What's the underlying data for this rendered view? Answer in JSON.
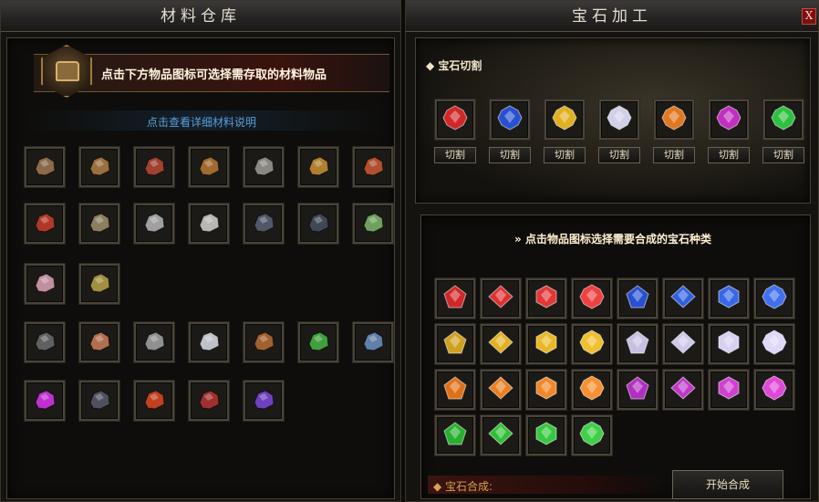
{
  "left_panel": {
    "title": "材料仓库",
    "hint": "点击下方物品图标可选择需存取的材料物品",
    "detail_link": "点击查看详细材料说明",
    "rows": [
      [
        {
          "icon": "wood-logs-icon",
          "c": "#8a6a4a"
        },
        {
          "icon": "wood-branch-icon",
          "c": "#9a7040"
        },
        {
          "icon": "red-wood-chips-icon",
          "c": "#a04030"
        },
        {
          "icon": "wood-chips-icon",
          "c": "#a06a30"
        },
        {
          "icon": "stone-slab-icon",
          "c": "#8a8880"
        },
        {
          "icon": "golden-planks-icon",
          "c": "#b08030"
        },
        {
          "icon": "red-planks-icon",
          "c": "#b05030"
        }
      ],
      [
        {
          "icon": "red-lumber-icon",
          "c": "#b03828"
        },
        {
          "icon": "mixed-ore-icon",
          "c": "#8a8060"
        },
        {
          "icon": "silver-ore-icon",
          "c": "#a0a0a0"
        },
        {
          "icon": "grey-ore-icon",
          "c": "#b8b8b0"
        },
        {
          "icon": "dark-ore-icon",
          "c": "#505868"
        },
        {
          "icon": "black-crystal-icon",
          "c": "#404858"
        },
        {
          "icon": "green-ore-icon",
          "c": "#70a060"
        }
      ],
      [
        {
          "icon": "pink-crystal-ore-icon",
          "c": "#c090a0"
        },
        {
          "icon": "gold-ore-icon",
          "c": "#a09040"
        }
      ],
      [
        {
          "icon": "coal-ore-icon",
          "c": "#606060"
        },
        {
          "icon": "copper-ore-icon",
          "c": "#b07050"
        },
        {
          "icon": "iron-ore-icon",
          "c": "#909090"
        },
        {
          "icon": "mithril-ore-icon",
          "c": "#c0c0c8"
        },
        {
          "icon": "amber-ore-icon",
          "c": "#a06030"
        },
        {
          "icon": "emerald-ore-icon",
          "c": "#40a040"
        },
        {
          "icon": "blue-stone-icon",
          "c": "#6080a8"
        }
      ],
      [
        {
          "icon": "purple-gem-icon",
          "c": "#c030d0"
        },
        {
          "icon": "obsidian-ore-icon",
          "c": "#505060"
        },
        {
          "icon": "fire-rune-icon",
          "c": "#c04020"
        },
        {
          "icon": "blood-rune-icon",
          "c": "#a03030"
        },
        {
          "icon": "violet-shard-icon",
          "c": "#7040c0"
        }
      ]
    ]
  },
  "right_panel": {
    "title": "宝石加工",
    "close_label": "X",
    "cut_section_title": "宝石切割",
    "cut_button_label": "切割",
    "cut_gems": [
      {
        "icon": "ruby-cluster-icon",
        "c": "#d02828"
      },
      {
        "icon": "sapphire-cluster-icon",
        "c": "#2850d0"
      },
      {
        "icon": "topaz-cluster-icon",
        "c": "#e0b020"
      },
      {
        "icon": "diamond-cluster-icon",
        "c": "#d0d0e8"
      },
      {
        "icon": "amber-cluster-icon",
        "c": "#e07820"
      },
      {
        "icon": "amethyst-cluster-icon",
        "c": "#c030c0"
      },
      {
        "icon": "emerald-cluster-icon",
        "c": "#30c040"
      }
    ],
    "synth_title": "点击物品图标选择需要合成的宝石种类",
    "synth_rows": [
      [
        {
          "icon": "ruby-gem-1-icon",
          "c": "#d02828"
        },
        {
          "icon": "ruby-gem-2-icon",
          "c": "#e03030"
        },
        {
          "icon": "ruby-gem-3-icon",
          "c": "#e03838"
        },
        {
          "icon": "ruby-gem-4-icon",
          "c": "#f04040"
        },
        {
          "icon": "sapphire-gem-1-icon",
          "c": "#2850d0"
        },
        {
          "icon": "sapphire-gem-2-icon",
          "c": "#3060e0"
        },
        {
          "icon": "sapphire-gem-3-icon",
          "c": "#3868e8"
        },
        {
          "icon": "sapphire-gem-4-icon",
          "c": "#4070f0"
        }
      ],
      [
        {
          "icon": "topaz-gem-1-icon",
          "c": "#d0a020"
        },
        {
          "icon": "topaz-gem-2-icon",
          "c": "#e0b020"
        },
        {
          "icon": "topaz-gem-3-icon",
          "c": "#e8b828"
        },
        {
          "icon": "topaz-gem-4-icon",
          "c": "#f0c030"
        },
        {
          "icon": "diamond-gem-1-icon",
          "c": "#c8c0e0"
        },
        {
          "icon": "diamond-gem-2-icon",
          "c": "#d0c8e8"
        },
        {
          "icon": "diamond-gem-3-icon",
          "c": "#d8d0f0"
        },
        {
          "icon": "diamond-gem-4-icon",
          "c": "#e0d8f8"
        }
      ],
      [
        {
          "icon": "amber-gem-1-icon",
          "c": "#e07018"
        },
        {
          "icon": "amber-gem-2-icon",
          "c": "#e88020"
        },
        {
          "icon": "amber-gem-3-icon",
          "c": "#f08828"
        },
        {
          "icon": "amber-gem-4-icon",
          "c": "#f89030"
        },
        {
          "icon": "amethyst-gem-1-icon",
          "c": "#b030c0"
        },
        {
          "icon": "amethyst-gem-2-icon",
          "c": "#c038c8"
        },
        {
          "icon": "amethyst-gem-3-icon",
          "c": "#d040d0"
        },
        {
          "icon": "amethyst-gem-4-icon",
          "c": "#e048d8"
        }
      ],
      [
        {
          "icon": "emerald-gem-1-icon",
          "c": "#28b030"
        },
        {
          "icon": "emerald-gem-2-icon",
          "c": "#30c038"
        },
        {
          "icon": "emerald-gem-3-icon",
          "c": "#38c840"
        },
        {
          "icon": "emerald-gem-4-icon",
          "c": "#40d048"
        }
      ]
    ],
    "footer_label": "宝石合成:",
    "start_button": "开始合成"
  }
}
